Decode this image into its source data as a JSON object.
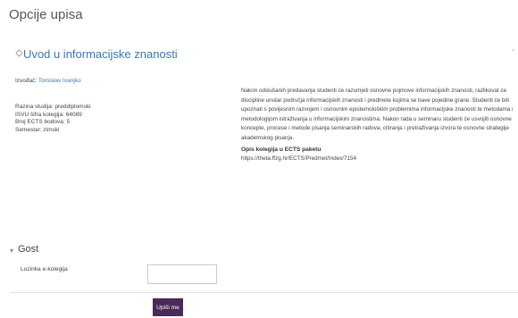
{
  "page": {
    "title": "Opcije upisa"
  },
  "course": {
    "title": "Uvod u informacijske znanosti",
    "instructor_label": "Izvođač:",
    "instructor_name": "Tomislav Ivanjko",
    "meta": [
      "Razina studija: preddiplomski",
      "ISVU šifra kolegija: 64089",
      "Broj ECTS bodova: 5",
      "Semestar: zimski"
    ],
    "description": "Nakon odslušanih predavanja studenti će razumjeti osnovne pojmove informacijskih znanosti, razlikovat će discipline unutar područja informacijskih znanosti i predmete kojima se bave pojedine grane. Studenti će biti upoznati s povijesnim razvojem i osnovnim epistemološkim problemima informacijske znanosti te metodama i metodologijom istraživanja u informacijskim znanostima. Nakon rada u seminaru studenti će usvojiti osnovne koncepte, procese i metode pisanja seminarskih radova, citiranja i pretraživanja izvora te osnovne strategije akademskog pisanja.",
    "ects_heading": "Opis kolegija u ECTS paketu",
    "ects_url": "https://theta.ffzg.hr/ECTS/Predmet/Index/7154"
  },
  "guest": {
    "section_title": "Gost",
    "password_label": "Lozinka e-kolegija",
    "password_value": "",
    "submit_label": "Upiši me"
  },
  "icons": {
    "course_icon": "course-icon",
    "toggle": "chevron-down-icon"
  },
  "colors": {
    "link": "#3a77b3",
    "button": "#4a2a57"
  }
}
